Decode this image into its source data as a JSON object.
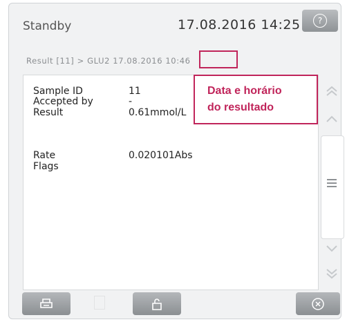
{
  "header": {
    "status": "Standby",
    "datetime": "17.08.2016 14:25",
    "help_icon": "question-circle-icon"
  },
  "breadcrumb": {
    "path": "Result [11] > GLU2 17.08.2016 ",
    "time": "10:46"
  },
  "details": {
    "sample_id_label": "Sample ID",
    "sample_id_value": "11",
    "accepted_by_label": "Accepted by",
    "accepted_by_value": "-",
    "result_label": "Result",
    "result_value": "0.61mmol/L",
    "rate_label": "Rate",
    "rate_value": "0.020101Abs",
    "flags_label": "Flags",
    "flags_value": ""
  },
  "callout": {
    "line1": "Data e horário",
    "line2": "do resultado"
  },
  "scrollbar": {
    "icons": [
      "double-chevron-up-icon",
      "chevron-up-icon",
      "menu-icon",
      "chevron-down-icon",
      "double-chevron-down-icon"
    ]
  },
  "toolbar": {
    "icons": [
      "print-icon",
      "document-icon",
      "unlock-icon",
      "close-circle-icon"
    ]
  },
  "colors": {
    "accent": "#c0245a",
    "button": "#9a9ea1",
    "background": "#f1f2f3"
  }
}
